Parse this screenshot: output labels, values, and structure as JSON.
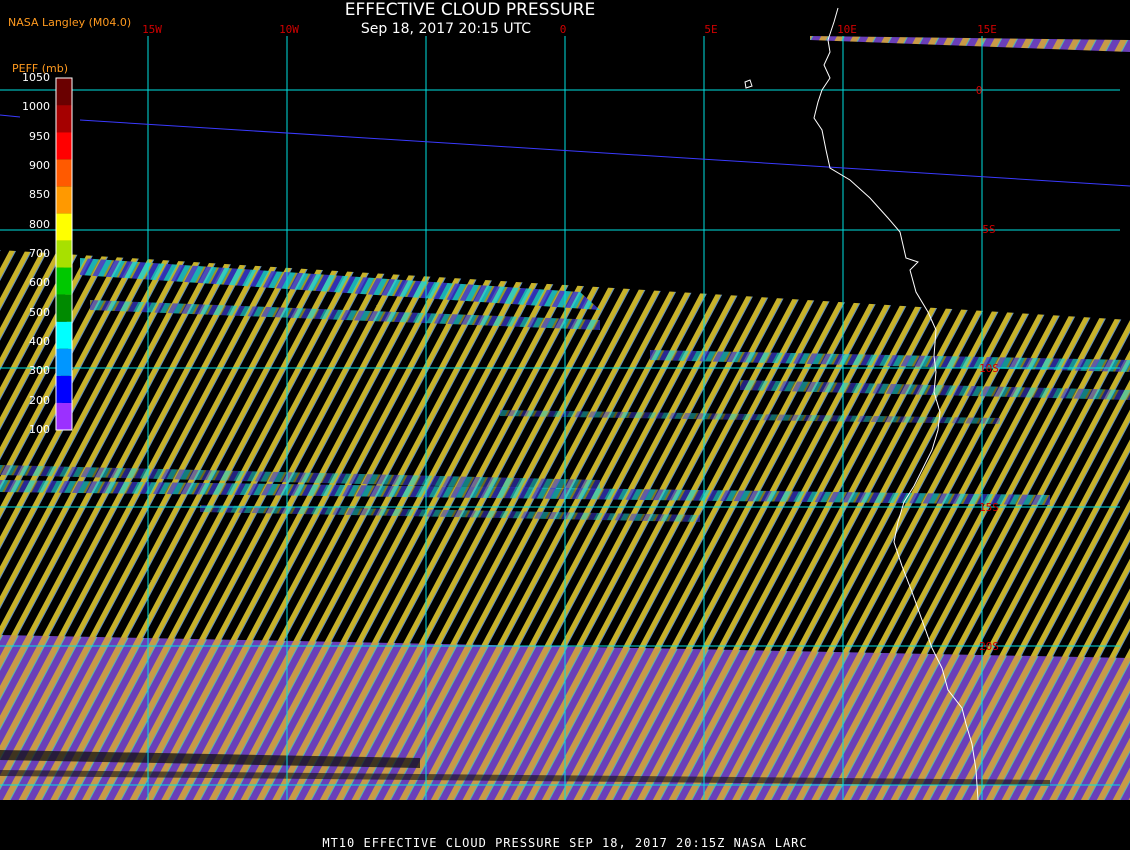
{
  "header": {
    "title": "EFFECTIVE CLOUD PRESSURE",
    "subtitle": "Sep 18, 2017 20:15 UTC",
    "agency": "NASA Langley (M04.0)"
  },
  "colorbar": {
    "title": "PEFF (mb)",
    "ticks": [
      "1050",
      "1000",
      "950",
      "900",
      "850",
      "800",
      "700",
      "600",
      "500",
      "400",
      "300",
      "200",
      "100"
    ],
    "colors": [
      "#6a0000",
      "#a50000",
      "#ff0000",
      "#ff5a00",
      "#ff9900",
      "#ffff00",
      "#a8e000",
      "#00c800",
      "#008a00",
      "#00ffff",
      "#0096ff",
      "#0000ff",
      "#9b30ff"
    ]
  },
  "grid": {
    "longitude_labels": [
      "15W",
      "10W",
      "0",
      "5E",
      "10E",
      "15E"
    ],
    "latitude_labels": [
      "0",
      "5S",
      "10S",
      "15S",
      "20S"
    ],
    "grid_color": "#00e0e0",
    "label_color": "#d00000"
  },
  "footer": {
    "text": "MT10  EFFECTIVE CLOUD PRESSURE  SEP 18, 2017 20:15Z  NASA LARC"
  }
}
